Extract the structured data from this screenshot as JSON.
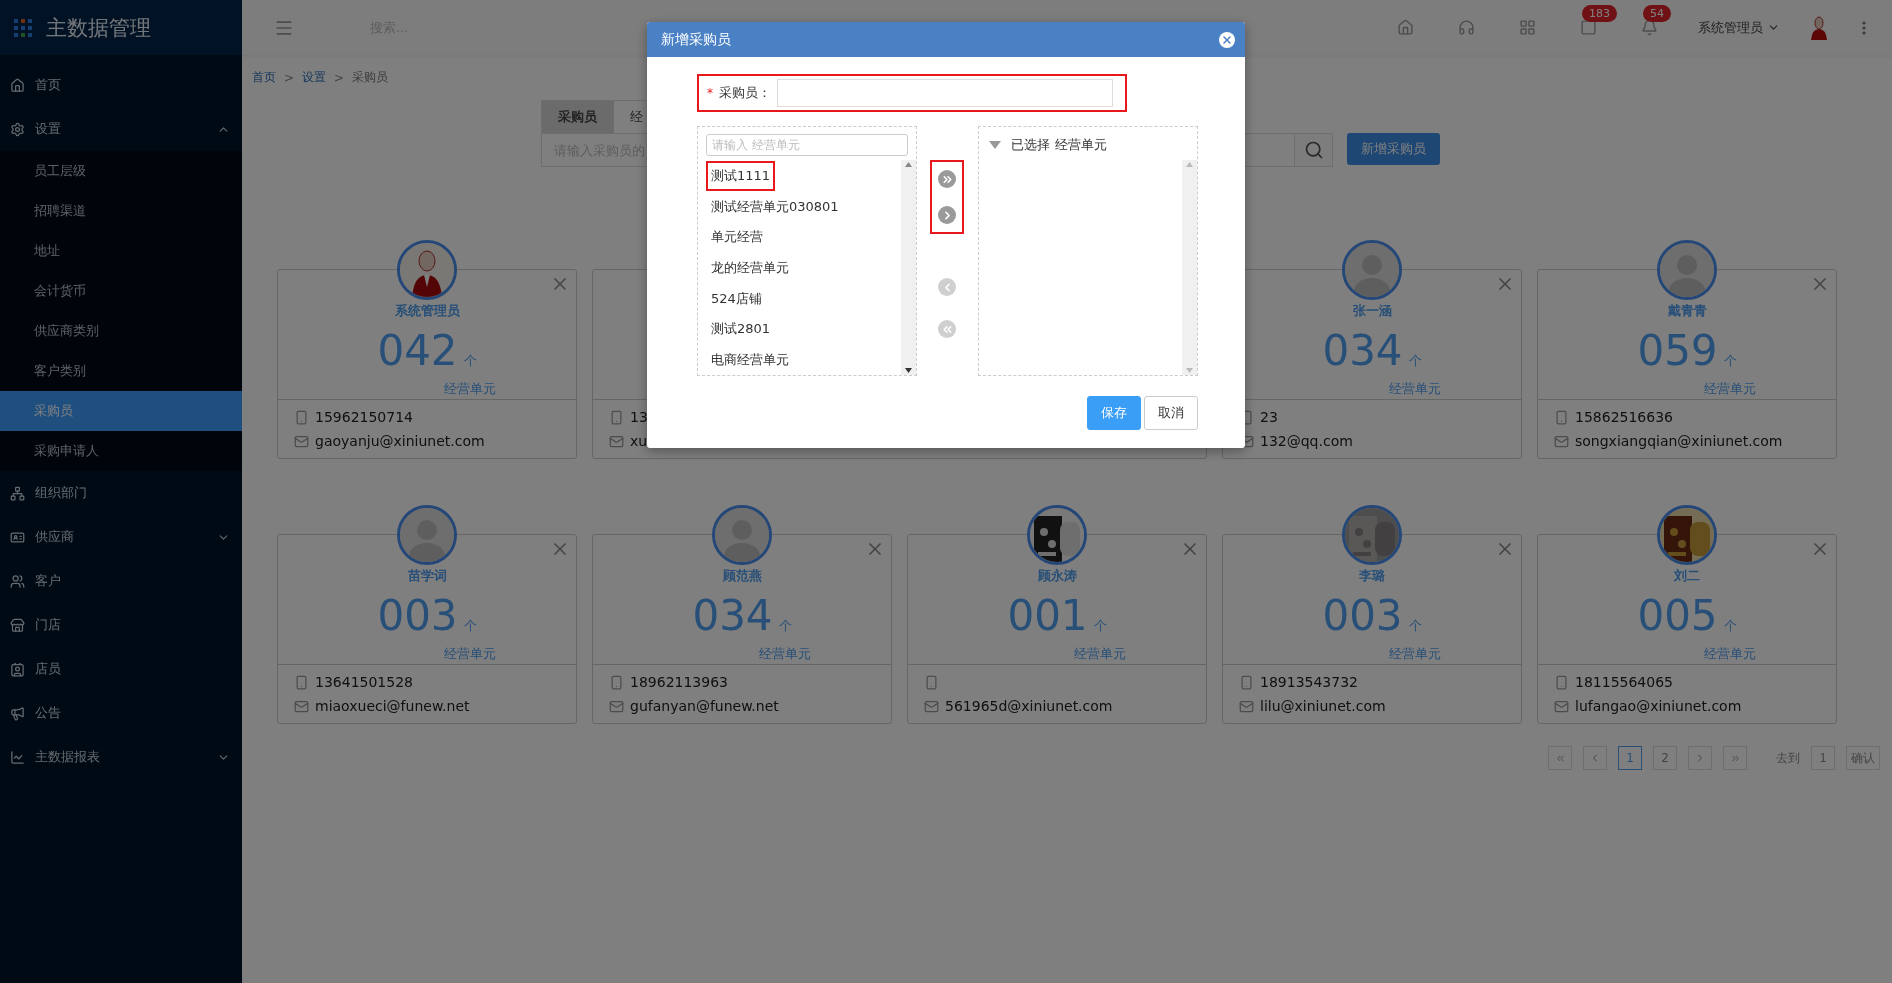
{
  "sidebar": {
    "logo": "主数据管理",
    "items": [
      {
        "label": "首页"
      },
      {
        "label": "设置",
        "expanded": true,
        "children": [
          {
            "label": "员工层级",
            "selected": false
          },
          {
            "label": "招聘渠道",
            "selected": false
          },
          {
            "label": "地址",
            "selected": false
          },
          {
            "label": "会计货币",
            "selected": false
          },
          {
            "label": "供应商类别",
            "selected": false
          },
          {
            "label": "客户类别",
            "selected": false
          },
          {
            "label": "采购员",
            "selected": true
          },
          {
            "label": "采购申请人",
            "selected": false
          }
        ]
      },
      {
        "label": "组织部门"
      },
      {
        "label": "供应商",
        "expanded": false
      },
      {
        "label": "客户"
      },
      {
        "label": "门店"
      },
      {
        "label": "店员"
      },
      {
        "label": "公告"
      },
      {
        "label": "主数据报表",
        "expanded": false
      }
    ]
  },
  "header": {
    "search_placeholder": "搜索...",
    "badges": [
      "183",
      "54"
    ],
    "user": "系统管理员"
  },
  "breadcrumb": {
    "items": [
      "首页",
      "设置",
      "采购员"
    ],
    "separator": ">"
  },
  "tabs": [
    {
      "label": "采购员",
      "selected": true
    },
    {
      "label": "经",
      "selected": false
    }
  ],
  "search": {
    "placeholder": "请输入采购员的"
  },
  "add_button": "新增采购员",
  "cards": [
    {
      "avatar": {
        "kind": "figure"
      },
      "name": "系统管理员",
      "count": "042",
      "unit": "个",
      "caption": "经营单元",
      "phone": "15962150714",
      "email": "gaoyanju@xiniunet.com"
    },
    {
      "phone": "13",
      "email": "xu"
    },
    {
      "avatar": {
        "kind": "silhouette"
      },
      "name": "张一涵",
      "count": "034",
      "unit": "个",
      "caption": "经营单元",
      "phone": "23",
      "email": "132@qq.com"
    },
    {
      "avatar": {
        "kind": "silhouette"
      },
      "name": "戴青青",
      "count": "059",
      "unit": "个",
      "caption": "经营单元",
      "phone": "15862516636",
      "email": "songxiangqian@xiniunet.com"
    },
    {
      "avatar": {
        "kind": "silhouette"
      },
      "name": "苗学词",
      "count": "003",
      "unit": "个",
      "caption": "经营单元",
      "phone": "13641501528",
      "email": "miaoxueci@funew.net"
    },
    {
      "avatar": {
        "kind": "silhouette"
      },
      "name": "顾范燕",
      "count": "034",
      "unit": "个",
      "caption": "经营单元",
      "phone": "18962113963",
      "email": "gufanyan@funew.net"
    },
    {
      "name": "顾永涛",
      "count": "001",
      "unit": "个",
      "caption": "经营单元",
      "email": "561965d@xiniunet.com"
    },
    {
      "name": "李璐",
      "count": "003",
      "unit": "个",
      "caption": "经营单元",
      "phone": "18913543732",
      "email": "lilu@xiniunet.com"
    },
    {
      "name": "刘二",
      "count": "005",
      "unit": "个",
      "caption": "经营单元",
      "phone": "18115564065",
      "email": "lufangao@xiniunet.com"
    }
  ],
  "pagination": {
    "pages": [
      {
        "label": "1",
        "selected": true
      },
      {
        "label": "2",
        "selected": false
      }
    ],
    "goto_label": "去到",
    "goto_value": "1",
    "confirm": "确认"
  },
  "modal": {
    "title": "新增采购员",
    "required_mark": "*",
    "field_label": "采购员：",
    "field_highlighted": true,
    "filter_placeholder": "请输入 经营单元",
    "options": [
      {
        "label": "测试1111",
        "highlighted": true
      },
      {
        "label": "测试经营单元030801",
        "highlighted": false
      },
      {
        "label": "单元经营",
        "highlighted": false
      },
      {
        "label": "龙的经营单元",
        "highlighted": false
      },
      {
        "label": "524店铺",
        "highlighted": false
      },
      {
        "label": "测试2801",
        "highlighted": false
      },
      {
        "label": "电商经营单元",
        "highlighted": false
      }
    ],
    "move_buttons": [
      {
        "kind": "all-right",
        "disabled": false
      },
      {
        "kind": "right",
        "disabled": false
      },
      {
        "kind": "left",
        "disabled": true
      },
      {
        "kind": "all-left",
        "disabled": true
      }
    ],
    "move_right_highlighted": true,
    "selected_title": "已选择 经营单元",
    "buttons": [
      {
        "label": "保存",
        "kind": "primary"
      },
      {
        "label": "取消",
        "kind": "default"
      }
    ]
  }
}
